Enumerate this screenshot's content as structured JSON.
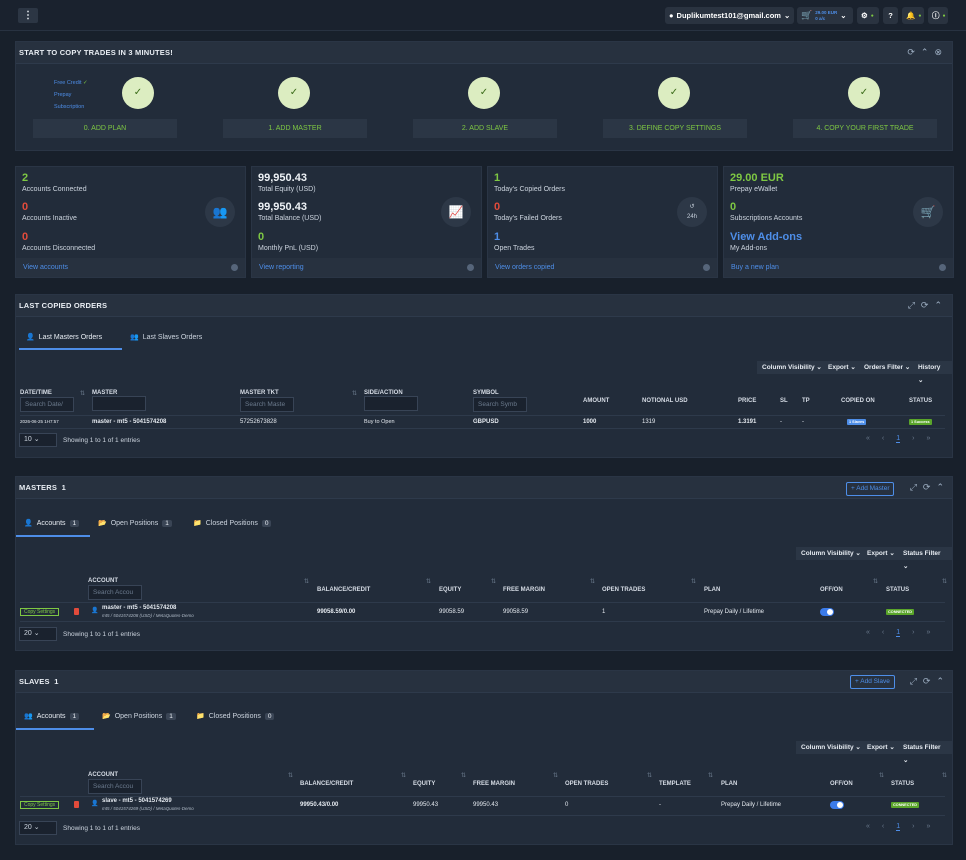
{
  "header": {
    "email": "Duplikumtest101@gmail.com",
    "wallet_amount": "29.00 EUR",
    "wallet_sub": "0 a/c"
  },
  "onboarding": {
    "title": "START TO COPY TRADES IN 3 MINUTES!",
    "plan_options": [
      "Free Credit",
      "Prepay",
      "Subscription"
    ],
    "steps": [
      "0. ADD PLAN",
      "1. ADD MASTER",
      "2. ADD SLAVE",
      "3. DEFINE COPY SETTINGS",
      "4. COPY YOUR FIRST TRADE"
    ],
    "step_mark": "✓"
  },
  "cards": [
    {
      "items": [
        {
          "value": "2",
          "label": "Accounts Connected"
        },
        {
          "value": "0",
          "label": "Accounts Inactive"
        },
        {
          "value": "0",
          "label": "Accounts Disconnected"
        }
      ],
      "link": "View accounts",
      "icon": "users-icon"
    },
    {
      "items": [
        {
          "value": "99,950.43",
          "label": "Total Equity (USD)"
        },
        {
          "value": "99,950.43",
          "label": "Total Balance (USD)"
        },
        {
          "value": "0",
          "label": "Monthly PnL (USD)"
        }
      ],
      "link": "View reporting",
      "icon": "chart-icon"
    },
    {
      "items": [
        {
          "value": "1",
          "label": "Today's Copied Orders"
        },
        {
          "value": "0",
          "label": "Today's Failed Orders"
        },
        {
          "value": "1",
          "label": "Open Trades"
        }
      ],
      "link": "View orders copied",
      "icon": "history-icon",
      "badge": "24h"
    },
    {
      "items": [
        {
          "value": "29.00 EUR",
          "label": "Prepay eWallet"
        },
        {
          "value": "0",
          "label": "Subscriptions Accounts"
        },
        {
          "value": "View Add-ons",
          "label": "My Add-ons"
        }
      ],
      "link": "Buy a new plan",
      "icon": "cart-icon"
    }
  ],
  "orders": {
    "title": "LAST COPIED ORDERS",
    "tabs": [
      "Last Masters Orders",
      "Last Slaves Orders"
    ],
    "tools": [
      "Column Visibility",
      "Export",
      "Orders Filter",
      "History"
    ],
    "columns": [
      "DATE/TIME",
      "MASTER",
      "MASTER TKT",
      "SIDE/ACTION",
      "SYMBOL",
      "AMOUNT",
      "NOTIONAL USD",
      "PRICE",
      "SL",
      "TP",
      "COPIED ON",
      "STATUS"
    ],
    "placeholders": {
      "date": "Search Date/",
      "tkt": "Search Maste",
      "symbol": "Search Symb"
    },
    "row": {
      "datetime": "2026-06-25 1H7:57",
      "master": "master - mt5 - 5041574208",
      "tkt": "57252673828",
      "side": "Buy to Open",
      "symbol": "GBPUSD",
      "amount": "1000",
      "notional": "1319",
      "price": "1.3191",
      "sl": "-",
      "tp": "-",
      "copied": "1 Slaves",
      "status": "1 Success"
    },
    "page_size": "10",
    "info": "Showing 1 to 1 of 1 entries",
    "page": "1"
  },
  "masters": {
    "title": "MASTERS",
    "count": "1",
    "add": "+ Add Master",
    "tabs": [
      {
        "label": "Accounts",
        "count": "1"
      },
      {
        "label": "Open Positions",
        "count": "1"
      },
      {
        "label": "Closed Positions",
        "count": "0"
      }
    ],
    "tools": [
      "Column Visibility",
      "Export",
      "Status Filter"
    ],
    "columns": [
      "ACCOUNT",
      "BALANCE/CREDIT",
      "EQUITY",
      "FREE MARGIN",
      "OPEN TRADES",
      "PLAN",
      "OFF/ON",
      "STATUS"
    ],
    "search": "Search Accou",
    "row": {
      "copy": "Copy Settings",
      "name": "master - mt5 - 5041574208",
      "sub": "mt5 / 5041574208 (USD) / MetaQuotes-Demo",
      "balance": "99058.59/0.00",
      "equity": "99058.59",
      "free": "99058.59",
      "open": "1",
      "plan": "Prepay Daily / Lifetime",
      "status": "CONNECTED"
    },
    "page_size": "20",
    "info": "Showing 1 to 1 of 1 entries",
    "page": "1"
  },
  "slaves": {
    "title": "SLAVES",
    "count": "1",
    "add": "+ Add Slave",
    "tabs": [
      {
        "label": "Accounts",
        "count": "1"
      },
      {
        "label": "Open Positions",
        "count": "1"
      },
      {
        "label": "Closed Positions",
        "count": "0"
      }
    ],
    "tools": [
      "Column Visibility",
      "Export",
      "Status Filter"
    ],
    "columns": [
      "ACCOUNT",
      "BALANCE/CREDIT",
      "EQUITY",
      "FREE MARGIN",
      "OPEN TRADES",
      "TEMPLATE",
      "PLAN",
      "OFF/ON",
      "STATUS"
    ],
    "search": "Search Accou",
    "row": {
      "copy": "Copy Settings",
      "name": "slave - mt5 - 5041574269",
      "sub": "mt5 / 5041574269 (USD) / MetaQuotes-Demo",
      "balance": "99950.43/0.00",
      "equity": "99950.43",
      "free": "99950.43",
      "open": "0",
      "template": "-",
      "plan": "Prepay Daily / Lifetime",
      "status": "CONNECTED"
    },
    "page_size": "20",
    "info": "Showing 1 to 1 of 1 entries",
    "page": "1"
  },
  "colors": {
    "green": "#7ec843",
    "red": "#e24b3b",
    "blue": "#4e8ee8",
    "bg": "#18202b",
    "panel": "#222c3a"
  }
}
